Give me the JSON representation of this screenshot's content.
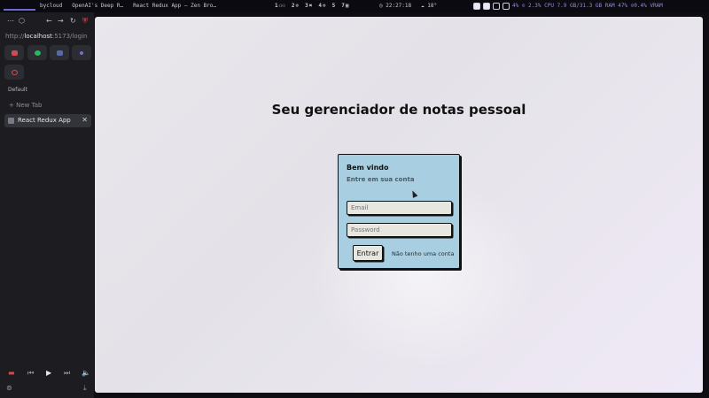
{
  "topbar": {
    "tasks": [
      "bycloud",
      "OpenAI's Deep R…",
      "React Redux App — Zen Bro…"
    ],
    "workspaces": [
      "1",
      "2",
      "3",
      "4",
      "5",
      "7"
    ],
    "clock": "22:27:18",
    "weather": "18°",
    "stats": "4% ⊙ 2.3% CPU  7.9 GB/31.3 GB RAM  47% ⊙0.4% VRAM"
  },
  "browser": {
    "url_prefix": "http://",
    "url_host": "localhost",
    "url_rest": ":5173/login",
    "section_label": "Default",
    "new_tab_label": "New Tab",
    "active_tab_label": "React Redux App",
    "colors": {
      "pin_red": "#d8484f",
      "pin_green": "#27b765",
      "pin_blue": "#5a6aa8",
      "pin_purple": "#7a6ad8"
    }
  },
  "page": {
    "headline": "Seu gerenciador de notas pessoal",
    "card": {
      "title": "Bem vindo",
      "subtitle": "Entre em sua conta",
      "email_placeholder": "Email",
      "password_placeholder": "Password",
      "submit_label": "Entrar",
      "no_account_link": "Não tenho uma conta"
    },
    "colors": {
      "card_bg": "#a7cfe1",
      "field_bg": "#e7e6df"
    }
  }
}
